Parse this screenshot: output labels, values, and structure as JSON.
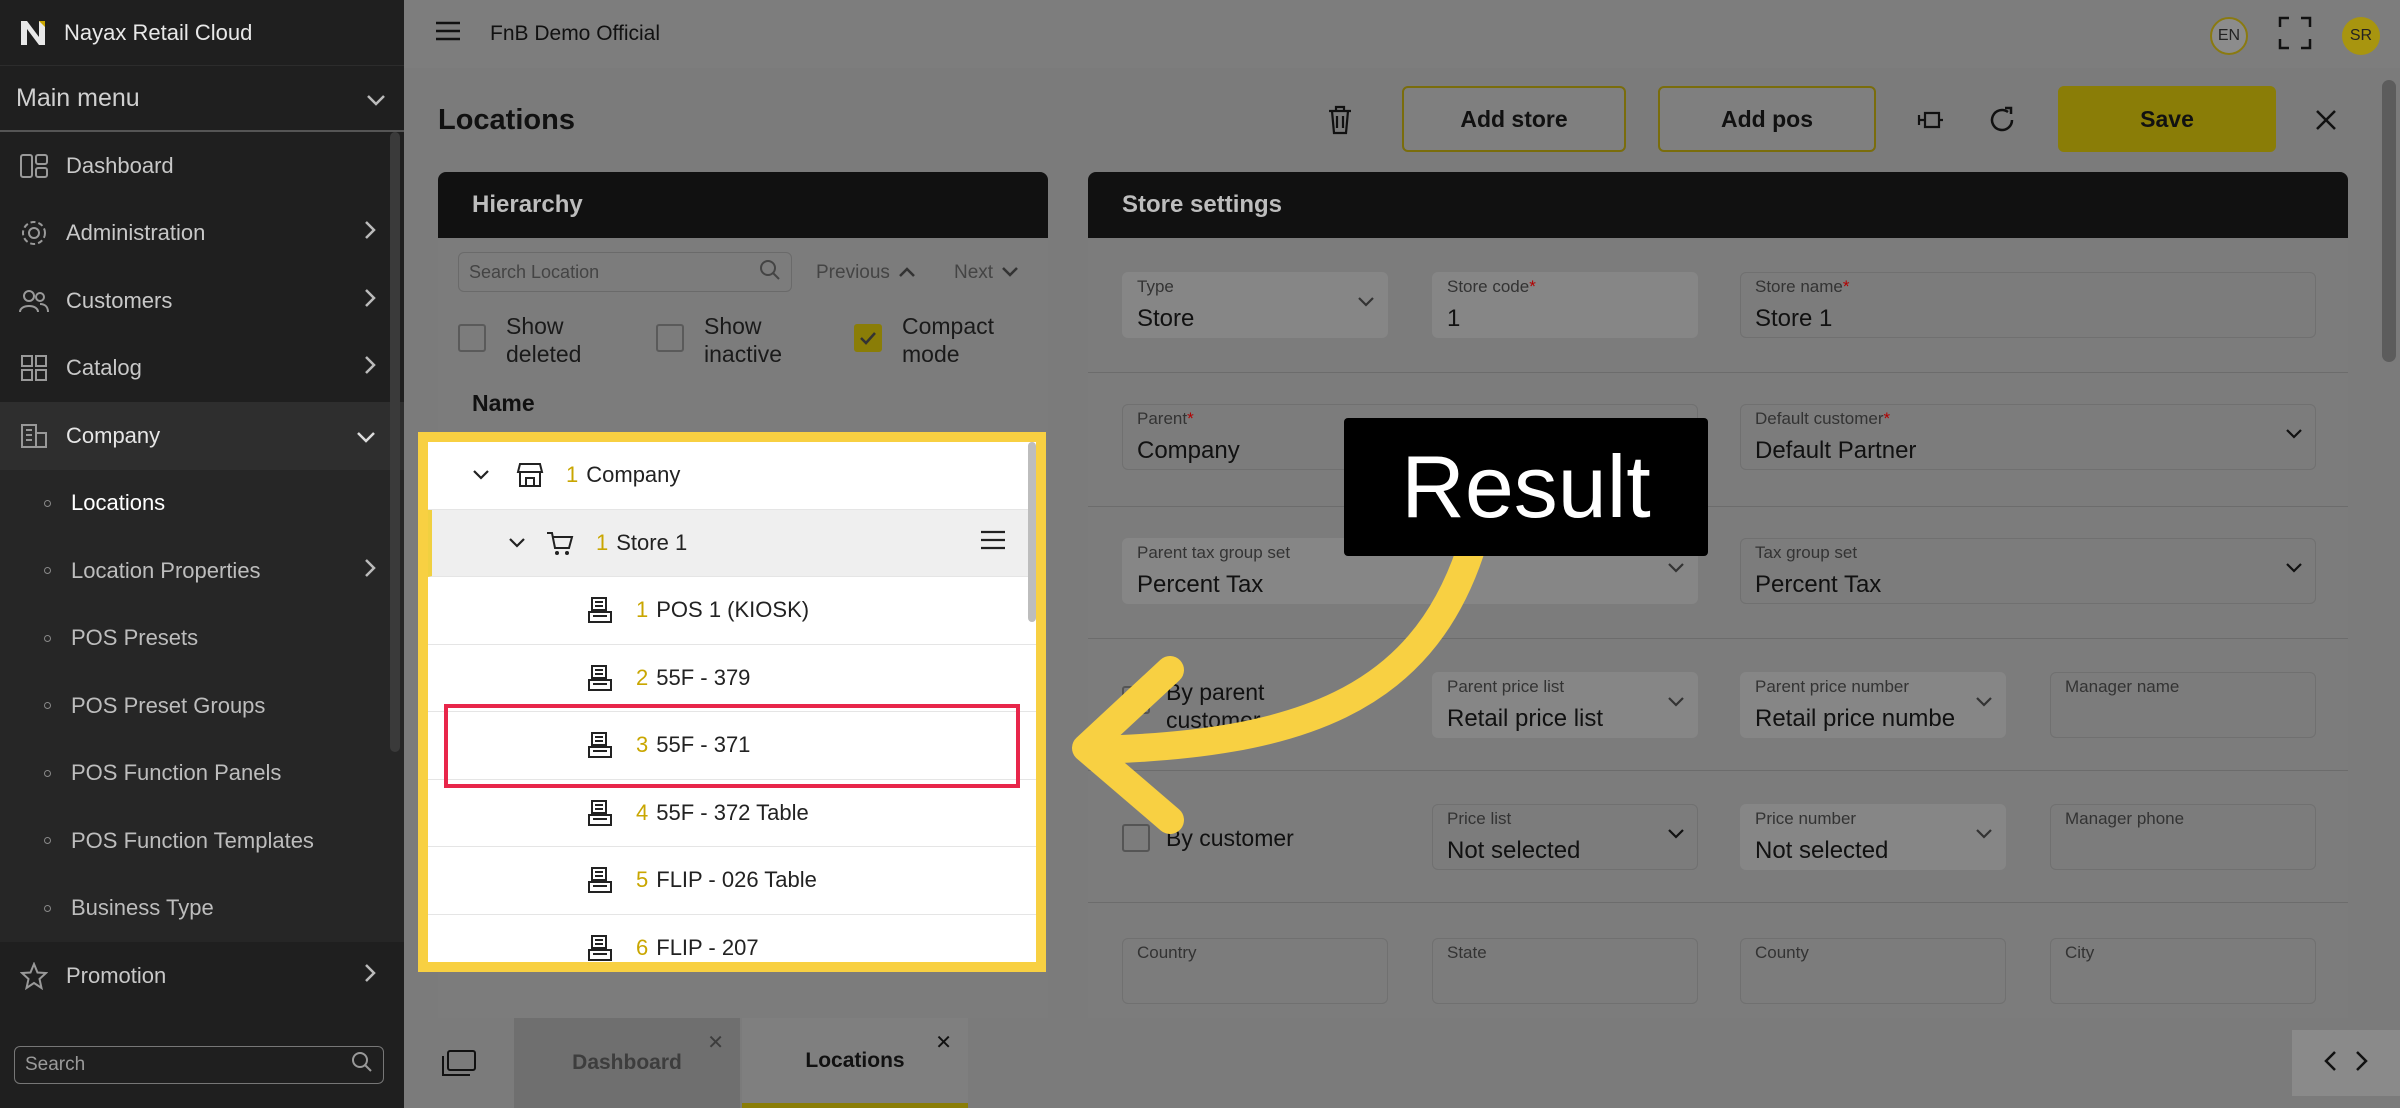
{
  "app": {
    "name": "Nayax Retail Cloud",
    "org": "FnB Demo Official",
    "lang": "EN",
    "user_initials": "SR"
  },
  "sidebar": {
    "main_menu": "Main menu",
    "items": [
      {
        "label": "Dashboard",
        "icon": "dashboard-icon"
      },
      {
        "label": "Administration",
        "icon": "gear-icon"
      },
      {
        "label": "Customers",
        "icon": "users-icon"
      },
      {
        "label": "Catalog",
        "icon": "grid-icon"
      },
      {
        "label": "Company",
        "icon": "building-icon"
      }
    ],
    "company_sub": [
      {
        "label": "Locations"
      },
      {
        "label": "Location Properties"
      },
      {
        "label": "POS Presets"
      },
      {
        "label": "POS Preset Groups"
      },
      {
        "label": "POS Function Panels"
      },
      {
        "label": "POS Function Templates"
      },
      {
        "label": "Business Type"
      }
    ],
    "promotion": "Promotion",
    "search_placeholder": "Search"
  },
  "page": {
    "title": "Locations",
    "add_store": "Add store",
    "add_pos": "Add pos",
    "save": "Save"
  },
  "hierarchy": {
    "title": "Hierarchy",
    "search_placeholder": "Search Location",
    "previous": "Previous",
    "next": "Next",
    "show_deleted": "Show deleted",
    "show_inactive": "Show inactive",
    "compact_mode": "Compact mode",
    "compact_checked": true,
    "name_header": "Name",
    "tree": [
      {
        "num": "1",
        "label": "Company",
        "level": 0,
        "icon": "company-icon"
      },
      {
        "num": "1",
        "label": "Store 1",
        "level": 1,
        "icon": "cart-icon",
        "selected": true
      },
      {
        "num": "1",
        "label": "POS 1 (KIOSK)",
        "level": 2,
        "icon": "pos-icon"
      },
      {
        "num": "2",
        "label": "55F - 379",
        "level": 2,
        "icon": "pos-icon"
      },
      {
        "num": "3",
        "label": "55F - 371",
        "level": 2,
        "icon": "pos-icon"
      },
      {
        "num": "4",
        "label": "55F - 372 Table",
        "level": 2,
        "icon": "pos-icon"
      },
      {
        "num": "5",
        "label": "FLIP - 026 Table",
        "level": 2,
        "icon": "pos-icon"
      },
      {
        "num": "6",
        "label": "FLIP - 207",
        "level": 2,
        "icon": "pos-icon"
      }
    ]
  },
  "store": {
    "title": "Store settings",
    "type_label": "Type",
    "type_value": "Store",
    "code_label": "Store code",
    "code_value": "1",
    "name_label": "Store name",
    "name_value": "Store 1",
    "parent_label": "Parent",
    "parent_value": "Company",
    "default_customer_label": "Default customer",
    "default_customer_value": "Default Partner",
    "parent_tax_label": "Parent tax group set",
    "parent_tax_value": "Percent Tax",
    "tax_label": "Tax group set",
    "tax_value": "Percent Tax",
    "by_parent_customer": "By parent customer",
    "parent_price_list_label": "Parent price list",
    "parent_price_list_value": "Retail price list",
    "parent_price_number_label": "Parent price number",
    "parent_price_number_value": "Retail price numbe",
    "manager_name_label": "Manager name",
    "by_customer": "By customer",
    "price_list_label": "Price list",
    "price_list_value": "Not selected",
    "price_number_label": "Price number",
    "price_number_value": "Not selected",
    "manager_phone_label": "Manager phone",
    "country_label": "Country",
    "state_label": "State",
    "county_label": "County",
    "city_label": "City"
  },
  "callout": {
    "text": "Result",
    "colors": {
      "highlight": "#f8d042",
      "box": "#e8264a",
      "arrow": "#f8d042"
    }
  },
  "tabs": [
    {
      "label": "Dashboard"
    },
    {
      "label": "Locations",
      "active": true
    }
  ]
}
